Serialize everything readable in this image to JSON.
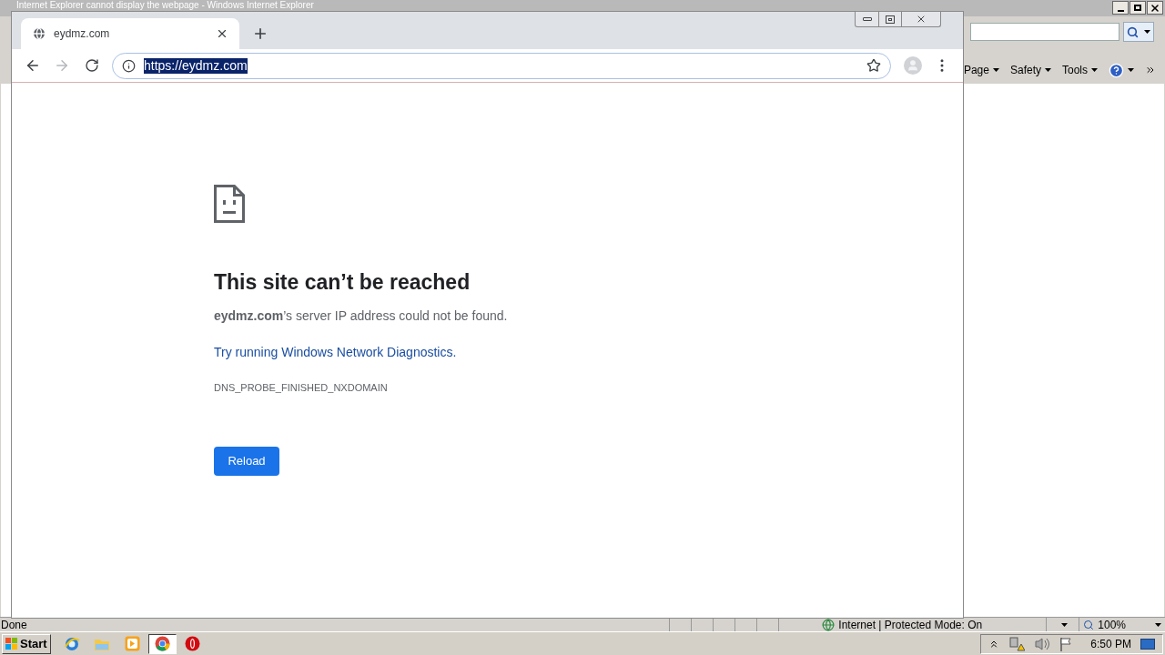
{
  "ie_window": {
    "title": "Internet Explorer cannot display the webpage - Windows Internet Explorer",
    "command_bar": [
      "Page",
      "Safety",
      "Tools"
    ],
    "status_text": "Done",
    "zone_text": "Internet | Protected Mode: On",
    "zoom": "100%"
  },
  "browser": {
    "tabs": [
      {
        "title": "eydmz.com",
        "selected": true
      }
    ],
    "address": "https://eydmz.com",
    "address_selected": true,
    "forward_disabled": true,
    "error": {
      "heading": "This site can’t be reached",
      "message": "**eydmz.com**’s server IP address could not be found.",
      "link": "Try running Windows Network Diagnostics.",
      "code": "DNS_PROBE_FINISHED_NXDOMAIN",
      "button": "Reload"
    }
  },
  "taskbar": {
    "start": "Start",
    "apps": [
      {
        "kind": "ie",
        "selected": false
      },
      {
        "kind": "folder",
        "selected": false
      },
      {
        "kind": "media",
        "selected": false
      },
      {
        "kind": "chrome",
        "selected": true
      },
      {
        "kind": "opera",
        "selected": false
      }
    ],
    "clock": "6:50 PM"
  }
}
